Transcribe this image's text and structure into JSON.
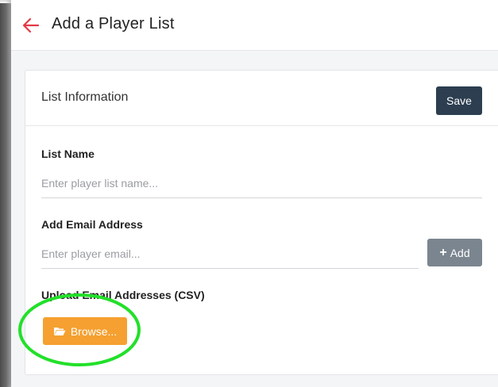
{
  "header": {
    "title": "Add a Player List",
    "back_icon": "arrow-left-icon"
  },
  "card": {
    "title": "List Information",
    "save_label": "Save"
  },
  "form": {
    "list_name": {
      "label": "List Name",
      "placeholder": "Enter player list name..."
    },
    "email": {
      "label": "Add Email Address",
      "placeholder": "Enter player email...",
      "add_plus": "+",
      "add_label": "Add"
    },
    "upload": {
      "label": "Upload Email Addresses (CSV)",
      "browse_label": "Browse...",
      "browse_icon": "folder-open-icon"
    }
  },
  "colors": {
    "accent_red": "#e53945",
    "save_bg": "#2c3e50",
    "add_bg": "#7b858f",
    "browse_bg": "#f5a030",
    "highlight": "#22e02a"
  }
}
